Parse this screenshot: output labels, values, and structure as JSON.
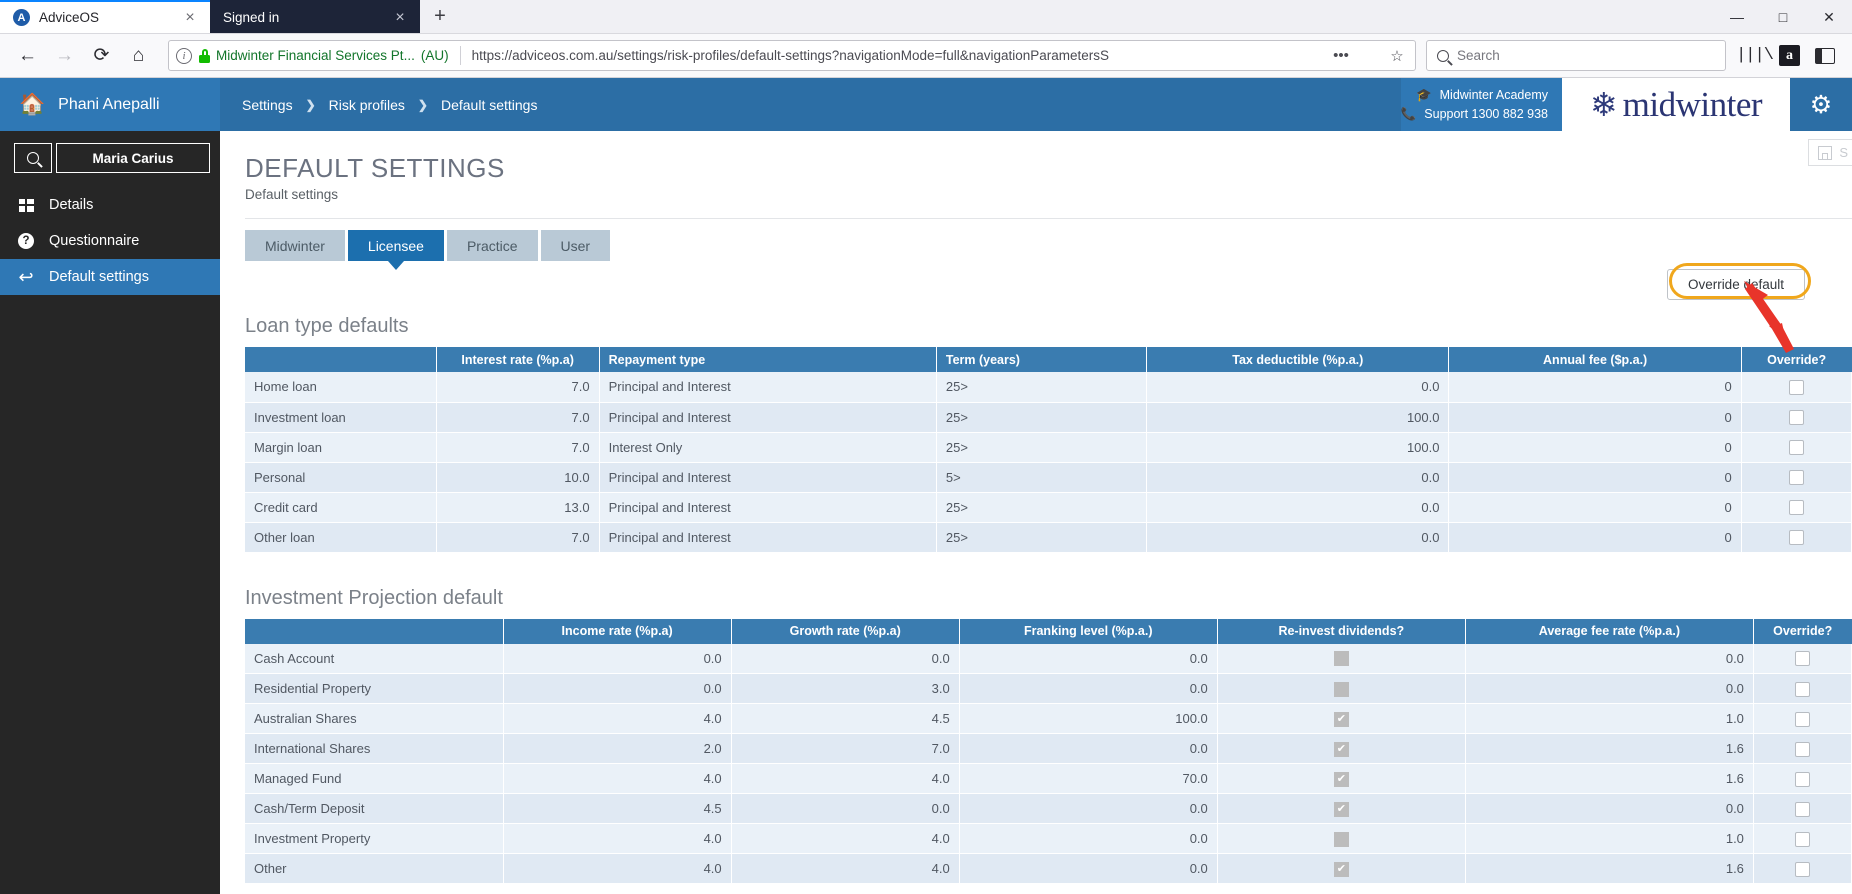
{
  "browser": {
    "tabs": [
      {
        "title": "AdviceOS",
        "favicon_letter": "A",
        "state": "active-win",
        "close_label": "×"
      },
      {
        "title": "Signed in",
        "favicon_letter": "",
        "state": "active-dark",
        "close_label": "×"
      }
    ],
    "new_tab_label": "+",
    "window_controls": {
      "minimize": "—",
      "maximize": "□",
      "close": "✕"
    },
    "nav": {
      "back": "←",
      "forward": "→",
      "reload": "⟳",
      "home": "⌂"
    },
    "urlbar": {
      "ev_org": "Midwinter Financial Services Pt...",
      "ev_country": "(AU)",
      "url_visible": "https://adviceos.com.au/settings/risk-profiles/default-settings?navigationMode=full&navigationParametersS",
      "url_dim_tail": "",
      "page_actions": "•••",
      "bookmark_star": "☆"
    },
    "search": {
      "placeholder": "Search"
    },
    "toolbar_icons": [
      "library-icon",
      "amazon-icon",
      "sidebar-icon"
    ],
    "amazon_letter": "a"
  },
  "appbar": {
    "user_name": "Phani Anepalli",
    "breadcrumbs": [
      "Settings",
      "Risk profiles",
      "Default settings"
    ],
    "crumb_separator": "❯",
    "academy_label": "Midwinter Academy",
    "support_label": "Support 1300 882 938",
    "brand_word": "midwinter",
    "brand_flake": "❄",
    "gear": "⚙"
  },
  "sidebar": {
    "client_name": "Maria Carius",
    "search_icon": "search-icon",
    "items": [
      {
        "label": "Details",
        "icon": "grid-icon",
        "active": false
      },
      {
        "label": "Questionnaire",
        "icon": "question-icon",
        "active": false
      },
      {
        "label": "Default settings",
        "icon": "back-arrow-icon",
        "active": true
      }
    ]
  },
  "page": {
    "title": "DEFAULT SETTINGS",
    "subtitle": "Default settings",
    "save_chip_label": "S",
    "tabs": [
      {
        "label": "Midwinter",
        "selected": false
      },
      {
        "label": "Licensee",
        "selected": true
      },
      {
        "label": "Practice",
        "selected": false
      },
      {
        "label": "User",
        "selected": false
      }
    ],
    "override_default_button": "Override default",
    "highlight_color": "#f0a71c",
    "arrow_color": "#e8342a",
    "accent_color": "#2f78b5",
    "header_color": "#3a7cb0"
  },
  "loan_table": {
    "title": "Loan type defaults",
    "columns": [
      "",
      "Interest rate (%p.a)",
      "Repayment type",
      "Term (years)",
      "Tax deductible (%p.a.)",
      "Annual fee ($p.a.)",
      "Override?"
    ],
    "rows": [
      {
        "name": "Home loan",
        "interest_rate": "7.0",
        "repayment_type": "Principal and Interest",
        "term": "25>",
        "tax_deductible": "0.0",
        "annual_fee": "0",
        "override": false
      },
      {
        "name": "Investment loan",
        "interest_rate": "7.0",
        "repayment_type": "Principal and Interest",
        "term": "25>",
        "tax_deductible": "100.0",
        "annual_fee": "0",
        "override": false
      },
      {
        "name": "Margin loan",
        "interest_rate": "7.0",
        "repayment_type": "Interest Only",
        "term": "25>",
        "tax_deductible": "100.0",
        "annual_fee": "0",
        "override": false
      },
      {
        "name": "Personal",
        "interest_rate": "10.0",
        "repayment_type": "Principal and Interest",
        "term": "5>",
        "tax_deductible": "0.0",
        "annual_fee": "0",
        "override": false
      },
      {
        "name": "Credit card",
        "interest_rate": "13.0",
        "repayment_type": "Principal and Interest",
        "term": "25>",
        "tax_deductible": "0.0",
        "annual_fee": "0",
        "override": false
      },
      {
        "name": "Other loan",
        "interest_rate": "7.0",
        "repayment_type": "Principal and Interest",
        "term": "25>",
        "tax_deductible": "0.0",
        "annual_fee": "0",
        "override": false
      }
    ]
  },
  "investment_table": {
    "title": "Investment Projection default",
    "columns": [
      "",
      "Income rate (%p.a)",
      "Growth rate (%p.a)",
      "Franking level (%p.a.)",
      "Re-invest dividends?",
      "Average fee rate (%p.a.)",
      "Override?"
    ],
    "rows": [
      {
        "name": "Cash Account",
        "income_rate": "0.0",
        "growth_rate": "0.0",
        "franking_level": "0.0",
        "reinvest": false,
        "avg_fee_rate": "0.0",
        "override": false
      },
      {
        "name": "Residential Property",
        "income_rate": "0.0",
        "growth_rate": "3.0",
        "franking_level": "0.0",
        "reinvest": false,
        "avg_fee_rate": "0.0",
        "override": false
      },
      {
        "name": "Australian Shares",
        "income_rate": "4.0",
        "growth_rate": "4.5",
        "franking_level": "100.0",
        "reinvest": true,
        "avg_fee_rate": "1.0",
        "override": false
      },
      {
        "name": "International Shares",
        "income_rate": "2.0",
        "growth_rate": "7.0",
        "franking_level": "0.0",
        "reinvest": true,
        "avg_fee_rate": "1.6",
        "override": false
      },
      {
        "name": "Managed Fund",
        "income_rate": "4.0",
        "growth_rate": "4.0",
        "franking_level": "70.0",
        "reinvest": true,
        "avg_fee_rate": "1.6",
        "override": false
      },
      {
        "name": "Cash/Term Deposit",
        "income_rate": "4.5",
        "growth_rate": "0.0",
        "franking_level": "0.0",
        "reinvest": true,
        "avg_fee_rate": "0.0",
        "override": false
      },
      {
        "name": "Investment Property",
        "income_rate": "4.0",
        "growth_rate": "4.0",
        "franking_level": "0.0",
        "reinvest": false,
        "avg_fee_rate": "1.0",
        "override": false
      },
      {
        "name": "Other",
        "income_rate": "4.0",
        "growth_rate": "4.0",
        "franking_level": "0.0",
        "reinvest": true,
        "avg_fee_rate": "1.6",
        "override": false
      }
    ]
  }
}
